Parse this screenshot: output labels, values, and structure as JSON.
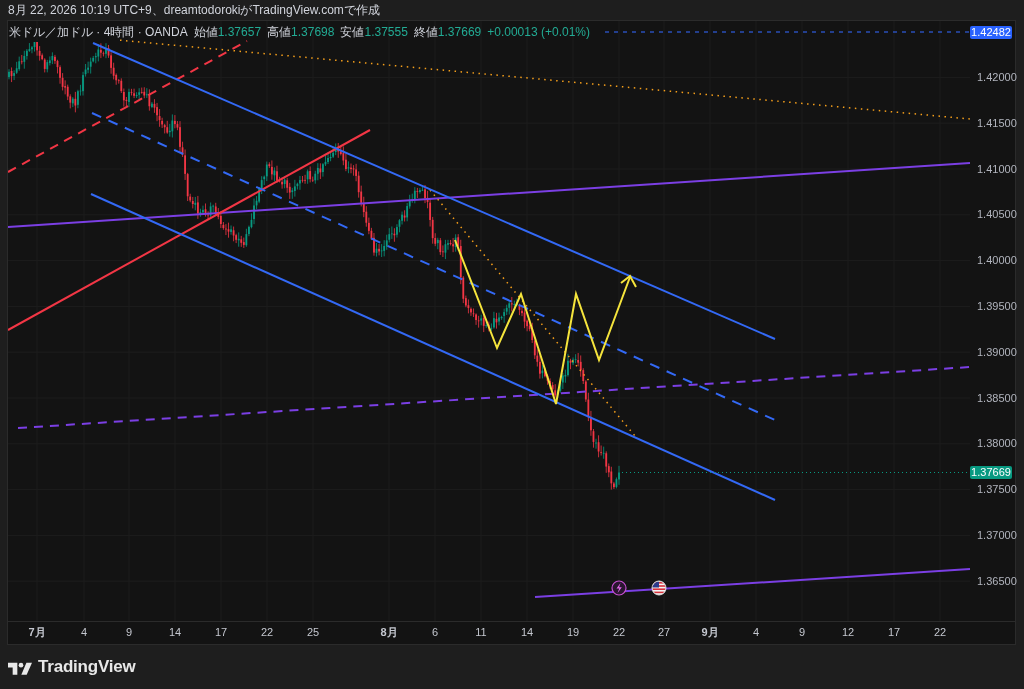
{
  "caption": "8月 22, 2026 10:19 UTC+9、dreamtodorokiがTradingView.comで作成",
  "legend": {
    "title": "米ドル／加ドル · 4時間 · OANDA",
    "ohlc": [
      {
        "label": "始値",
        "value": "1.37657"
      },
      {
        "label": "高値",
        "value": "1.37698"
      },
      {
        "label": "安値",
        "value": "1.37555"
      },
      {
        "label": "終値",
        "value": "1.37669"
      }
    ],
    "change": "+0.00013 (+0.01%)"
  },
  "price_axis": {
    "labels": [
      "1.42000",
      "1.41500",
      "1.41000",
      "1.40500",
      "1.40000",
      "1.39500",
      "1.39000",
      "1.38500",
      "1.38000",
      "1.37500",
      "1.37000",
      "1.36500"
    ],
    "markers": [
      {
        "kind": "high",
        "value": "1.42482"
      },
      {
        "kind": "last",
        "value": "1.37669"
      }
    ]
  },
  "time_axis": {
    "labels": [
      {
        "text": "7月",
        "kind": "month"
      },
      {
        "text": "4",
        "kind": "day"
      },
      {
        "text": "9",
        "kind": "day"
      },
      {
        "text": "14",
        "kind": "day"
      },
      {
        "text": "17",
        "kind": "day"
      },
      {
        "text": "22",
        "kind": "day"
      },
      {
        "text": "25",
        "kind": "day"
      },
      {
        "text": "8月",
        "kind": "month"
      },
      {
        "text": "6",
        "kind": "day"
      },
      {
        "text": "11",
        "kind": "day"
      },
      {
        "text": "14",
        "kind": "day"
      },
      {
        "text": "19",
        "kind": "day"
      },
      {
        "text": "22",
        "kind": "day"
      },
      {
        "text": "27",
        "kind": "day"
      },
      {
        "text": "9月",
        "kind": "month"
      },
      {
        "text": "4",
        "kind": "day"
      },
      {
        "text": "9",
        "kind": "day"
      },
      {
        "text": "12",
        "kind": "day"
      },
      {
        "text": "17",
        "kind": "day"
      },
      {
        "text": "22",
        "kind": "day"
      }
    ]
  },
  "footer": {
    "brand": "TradingView"
  }
}
